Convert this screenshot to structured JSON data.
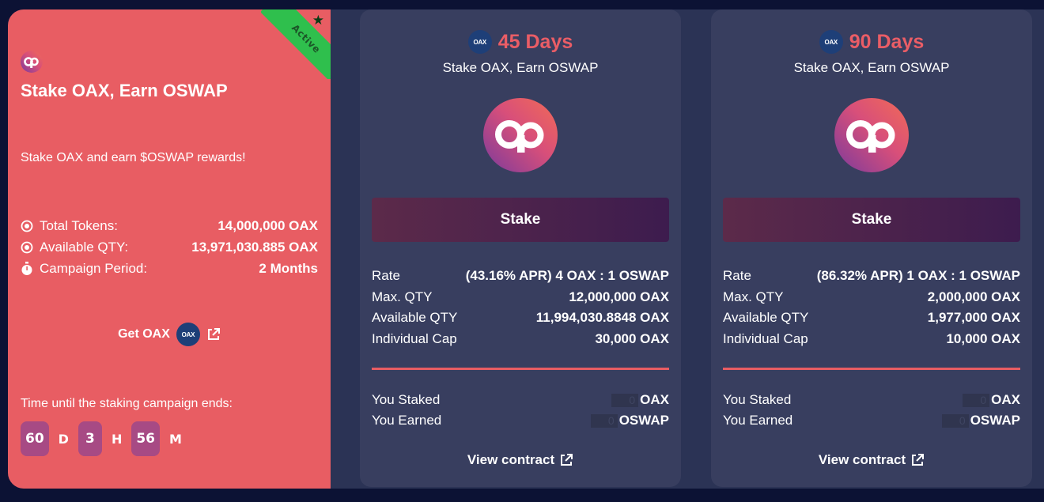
{
  "campaign": {
    "status": "Active",
    "title": "Stake OAX, Earn OSWAP",
    "description": "Stake OAX and earn $OSWAP rewards!",
    "stats": [
      {
        "icon": "target-icon",
        "label": "Total Tokens:",
        "value": "14,000,000 OAX"
      },
      {
        "icon": "target-icon",
        "label": "Available QTY:",
        "value": "13,971,030.885 OAX"
      },
      {
        "icon": "stopwatch-icon",
        "label": "Campaign Period:",
        "value": "2 Months"
      }
    ],
    "get_token_label": "Get OAX",
    "token_badge": "OAX",
    "time_label": "Time until the staking campaign ends:",
    "countdown": {
      "days": "60",
      "days_unit": "D",
      "hours": "3",
      "hours_unit": "H",
      "minutes": "56",
      "minutes_unit": "M"
    }
  },
  "options": [
    {
      "days": "45 Days",
      "token_badge": "OAX",
      "subtitle": "Stake OAX, Earn OSWAP",
      "stake_label": "Stake",
      "rate_label": "Rate",
      "rate_value": "(43.16% APR) 4 OAX : 1 OSWAP",
      "max_label": "Max. QTY",
      "max_value": "12,000,000 OAX",
      "avail_label": "Available QTY",
      "avail_value": "11,994,030.8848 OAX",
      "cap_label": "Individual Cap",
      "cap_value": "30,000 OAX",
      "staked_label": "You Staked",
      "staked_amount": "0",
      "staked_unit": "OAX",
      "earned_label": "You Earned",
      "earned_amount": "0",
      "earned_unit": "OSWAP",
      "view_label": "View contract"
    },
    {
      "days": "90 Days",
      "token_badge": "OAX",
      "subtitle": "Stake OAX, Earn OSWAP",
      "stake_label": "Stake",
      "rate_label": "Rate",
      "rate_value": "(86.32% APR) 1 OAX : 1 OSWAP",
      "max_label": "Max. QTY",
      "max_value": "2,000,000 OAX",
      "avail_label": "Available QTY",
      "avail_value": "1,977,000 OAX",
      "cap_label": "Individual Cap",
      "cap_value": "10,000 OAX",
      "staked_label": "You Staked",
      "staked_amount": "0",
      "staked_unit": "OAX",
      "earned_label": "You Earned",
      "earned_amount": "0",
      "earned_unit": "OSWAP",
      "view_label": "View contract"
    }
  ],
  "colors": {
    "campaign_bg": "#e85d63",
    "card_bg": "#383e5f",
    "accent": "#ea5d66",
    "active": "#2fbf4d"
  }
}
